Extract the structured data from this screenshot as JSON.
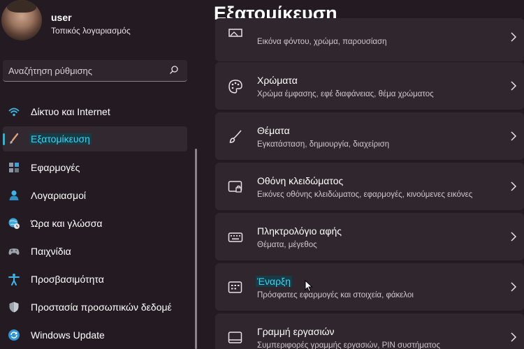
{
  "user": {
    "name": "user",
    "account_type": "Τοπικός λογαριασμός"
  },
  "search": {
    "placeholder": "Αναζήτηση ρύθμισης",
    "icon": "search-icon"
  },
  "sidebar": {
    "items": [
      {
        "label": "Δίκτυο και Internet",
        "icon": "wifi-icon",
        "active": false
      },
      {
        "label": "Εξατομίκευση",
        "icon": "brush-icon",
        "active": true
      },
      {
        "label": "Εφαρμογές",
        "icon": "apps-icon",
        "active": false
      },
      {
        "label": "Λογαριασμοί",
        "icon": "person-icon",
        "active": false
      },
      {
        "label": "Ώρα και γλώσσα",
        "icon": "globe-clock-icon",
        "active": false
      },
      {
        "label": "Παιχνίδια",
        "icon": "gamepad-icon",
        "active": false
      },
      {
        "label": "Προσβασιμότητα",
        "icon": "accessibility-icon",
        "active": false
      },
      {
        "label": "Προστασία προσωπικών δεδομέ",
        "icon": "shield-icon",
        "active": false
      },
      {
        "label": "Windows Update",
        "icon": "update-icon",
        "active": false
      }
    ]
  },
  "main": {
    "title": "Εξατομίκευση",
    "cards": [
      {
        "title": "",
        "subtitle": "Εικόνα φόντου, χρώμα, παρουσίαση",
        "icon": "image-icon"
      },
      {
        "title": "Χρώματα",
        "subtitle": "Χρώμα έμφασης, εφέ διαφάνειας, θέμα χρώματος",
        "icon": "palette-icon"
      },
      {
        "title": "Θέματα",
        "subtitle": "Εγκατάσταση, δημιουργία, διαχείριση",
        "icon": "brush-icon"
      },
      {
        "title": "Οθόνη κλειδώματος",
        "subtitle": "Εικόνες οθόνης κλειδώματος, εφαρμογές, κινούμενες εικόνες",
        "icon": "lock-screen-icon"
      },
      {
        "title": "Πληκτρολόγιο αφής",
        "subtitle": "Θέματα, μέγεθος",
        "icon": "keyboard-icon"
      },
      {
        "title": "Έναρξη",
        "subtitle": "Πρόσφατες εφαρμογές και στοιχεία, φάκελοι",
        "icon": "start-icon"
      },
      {
        "title": "Γραμμή εργασιών",
        "subtitle": "Συμπεριφορές γραμμής εργασιών, PIN συστήματος",
        "icon": "taskbar-icon"
      }
    ]
  },
  "colors": {
    "accent": "#45d0ee",
    "background": "#241b22",
    "card": "#30262d"
  }
}
